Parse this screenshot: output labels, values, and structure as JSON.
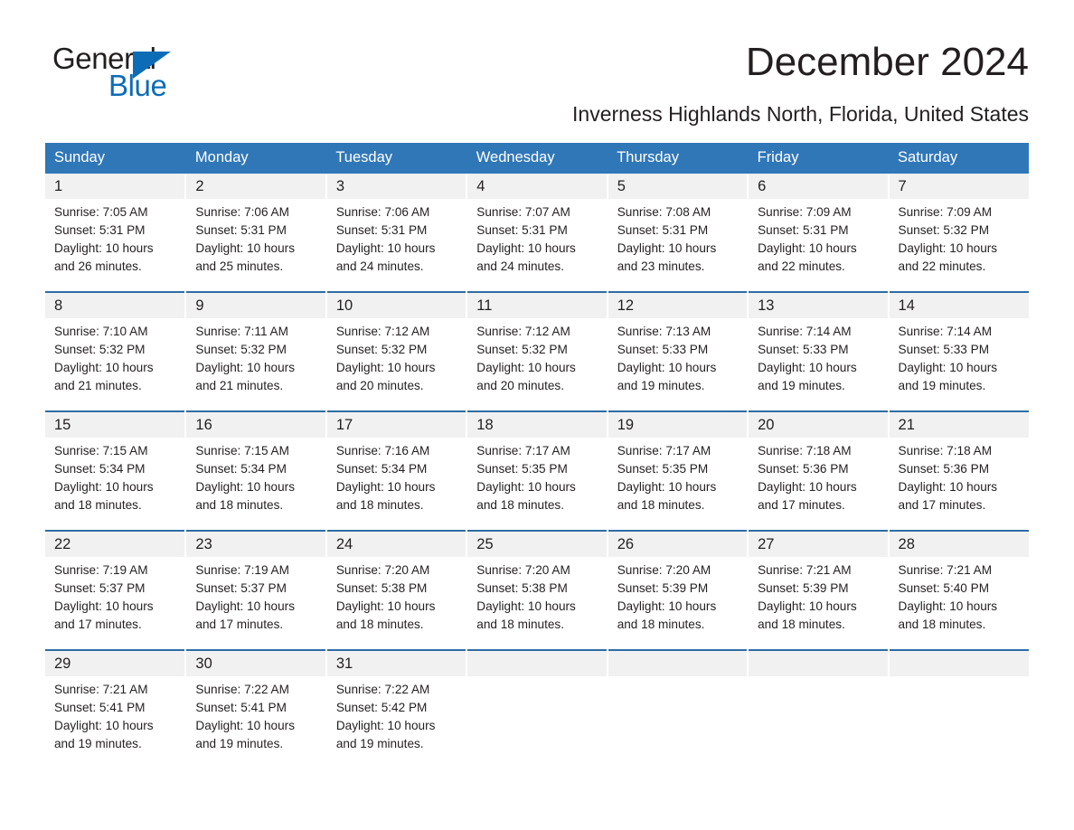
{
  "brand": {
    "name_part1": "General",
    "name_part2": "Blue",
    "logo_icon": "triangle-icon"
  },
  "header": {
    "title": "December 2024",
    "subtitle": "Inverness Highlands North, Florida, United States"
  },
  "colors": {
    "header_blue": "#3077b8",
    "rule_blue": "#2e6da4",
    "brand_blue": "#0d6cb6",
    "date_band_gray": "#f1f1f1",
    "text": "#231f20"
  },
  "weekdays": [
    "Sunday",
    "Monday",
    "Tuesday",
    "Wednesday",
    "Thursday",
    "Friday",
    "Saturday"
  ],
  "weeks": [
    {
      "dates": [
        "1",
        "2",
        "3",
        "4",
        "5",
        "6",
        "7"
      ],
      "cells": [
        {
          "sunrise": "Sunrise: 7:05 AM",
          "sunset": "Sunset: 5:31 PM",
          "daylight1": "Daylight: 10 hours",
          "daylight2": "and 26 minutes."
        },
        {
          "sunrise": "Sunrise: 7:06 AM",
          "sunset": "Sunset: 5:31 PM",
          "daylight1": "Daylight: 10 hours",
          "daylight2": "and 25 minutes."
        },
        {
          "sunrise": "Sunrise: 7:06 AM",
          "sunset": "Sunset: 5:31 PM",
          "daylight1": "Daylight: 10 hours",
          "daylight2": "and 24 minutes."
        },
        {
          "sunrise": "Sunrise: 7:07 AM",
          "sunset": "Sunset: 5:31 PM",
          "daylight1": "Daylight: 10 hours",
          "daylight2": "and 24 minutes."
        },
        {
          "sunrise": "Sunrise: 7:08 AM",
          "sunset": "Sunset: 5:31 PM",
          "daylight1": "Daylight: 10 hours",
          "daylight2": "and 23 minutes."
        },
        {
          "sunrise": "Sunrise: 7:09 AM",
          "sunset": "Sunset: 5:31 PM",
          "daylight1": "Daylight: 10 hours",
          "daylight2": "and 22 minutes."
        },
        {
          "sunrise": "Sunrise: 7:09 AM",
          "sunset": "Sunset: 5:32 PM",
          "daylight1": "Daylight: 10 hours",
          "daylight2": "and 22 minutes."
        }
      ]
    },
    {
      "dates": [
        "8",
        "9",
        "10",
        "11",
        "12",
        "13",
        "14"
      ],
      "cells": [
        {
          "sunrise": "Sunrise: 7:10 AM",
          "sunset": "Sunset: 5:32 PM",
          "daylight1": "Daylight: 10 hours",
          "daylight2": "and 21 minutes."
        },
        {
          "sunrise": "Sunrise: 7:11 AM",
          "sunset": "Sunset: 5:32 PM",
          "daylight1": "Daylight: 10 hours",
          "daylight2": "and 21 minutes."
        },
        {
          "sunrise": "Sunrise: 7:12 AM",
          "sunset": "Sunset: 5:32 PM",
          "daylight1": "Daylight: 10 hours",
          "daylight2": "and 20 minutes."
        },
        {
          "sunrise": "Sunrise: 7:12 AM",
          "sunset": "Sunset: 5:32 PM",
          "daylight1": "Daylight: 10 hours",
          "daylight2": "and 20 minutes."
        },
        {
          "sunrise": "Sunrise: 7:13 AM",
          "sunset": "Sunset: 5:33 PM",
          "daylight1": "Daylight: 10 hours",
          "daylight2": "and 19 minutes."
        },
        {
          "sunrise": "Sunrise: 7:14 AM",
          "sunset": "Sunset: 5:33 PM",
          "daylight1": "Daylight: 10 hours",
          "daylight2": "and 19 minutes."
        },
        {
          "sunrise": "Sunrise: 7:14 AM",
          "sunset": "Sunset: 5:33 PM",
          "daylight1": "Daylight: 10 hours",
          "daylight2": "and 19 minutes."
        }
      ]
    },
    {
      "dates": [
        "15",
        "16",
        "17",
        "18",
        "19",
        "20",
        "21"
      ],
      "cells": [
        {
          "sunrise": "Sunrise: 7:15 AM",
          "sunset": "Sunset: 5:34 PM",
          "daylight1": "Daylight: 10 hours",
          "daylight2": "and 18 minutes."
        },
        {
          "sunrise": "Sunrise: 7:15 AM",
          "sunset": "Sunset: 5:34 PM",
          "daylight1": "Daylight: 10 hours",
          "daylight2": "and 18 minutes."
        },
        {
          "sunrise": "Sunrise: 7:16 AM",
          "sunset": "Sunset: 5:34 PM",
          "daylight1": "Daylight: 10 hours",
          "daylight2": "and 18 minutes."
        },
        {
          "sunrise": "Sunrise: 7:17 AM",
          "sunset": "Sunset: 5:35 PM",
          "daylight1": "Daylight: 10 hours",
          "daylight2": "and 18 minutes."
        },
        {
          "sunrise": "Sunrise: 7:17 AM",
          "sunset": "Sunset: 5:35 PM",
          "daylight1": "Daylight: 10 hours",
          "daylight2": "and 18 minutes."
        },
        {
          "sunrise": "Sunrise: 7:18 AM",
          "sunset": "Sunset: 5:36 PM",
          "daylight1": "Daylight: 10 hours",
          "daylight2": "and 17 minutes."
        },
        {
          "sunrise": "Sunrise: 7:18 AM",
          "sunset": "Sunset: 5:36 PM",
          "daylight1": "Daylight: 10 hours",
          "daylight2": "and 17 minutes."
        }
      ]
    },
    {
      "dates": [
        "22",
        "23",
        "24",
        "25",
        "26",
        "27",
        "28"
      ],
      "cells": [
        {
          "sunrise": "Sunrise: 7:19 AM",
          "sunset": "Sunset: 5:37 PM",
          "daylight1": "Daylight: 10 hours",
          "daylight2": "and 17 minutes."
        },
        {
          "sunrise": "Sunrise: 7:19 AM",
          "sunset": "Sunset: 5:37 PM",
          "daylight1": "Daylight: 10 hours",
          "daylight2": "and 17 minutes."
        },
        {
          "sunrise": "Sunrise: 7:20 AM",
          "sunset": "Sunset: 5:38 PM",
          "daylight1": "Daylight: 10 hours",
          "daylight2": "and 18 minutes."
        },
        {
          "sunrise": "Sunrise: 7:20 AM",
          "sunset": "Sunset: 5:38 PM",
          "daylight1": "Daylight: 10 hours",
          "daylight2": "and 18 minutes."
        },
        {
          "sunrise": "Sunrise: 7:20 AM",
          "sunset": "Sunset: 5:39 PM",
          "daylight1": "Daylight: 10 hours",
          "daylight2": "and 18 minutes."
        },
        {
          "sunrise": "Sunrise: 7:21 AM",
          "sunset": "Sunset: 5:39 PM",
          "daylight1": "Daylight: 10 hours",
          "daylight2": "and 18 minutes."
        },
        {
          "sunrise": "Sunrise: 7:21 AM",
          "sunset": "Sunset: 5:40 PM",
          "daylight1": "Daylight: 10 hours",
          "daylight2": "and 18 minutes."
        }
      ]
    },
    {
      "dates": [
        "29",
        "30",
        "31",
        "",
        "",
        "",
        ""
      ],
      "cells": [
        {
          "sunrise": "Sunrise: 7:21 AM",
          "sunset": "Sunset: 5:41 PM",
          "daylight1": "Daylight: 10 hours",
          "daylight2": "and 19 minutes."
        },
        {
          "sunrise": "Sunrise: 7:22 AM",
          "sunset": "Sunset: 5:41 PM",
          "daylight1": "Daylight: 10 hours",
          "daylight2": "and 19 minutes."
        },
        {
          "sunrise": "Sunrise: 7:22 AM",
          "sunset": "Sunset: 5:42 PM",
          "daylight1": "Daylight: 10 hours",
          "daylight2": "and 19 minutes."
        },
        {
          "sunrise": "",
          "sunset": "",
          "daylight1": "",
          "daylight2": ""
        },
        {
          "sunrise": "",
          "sunset": "",
          "daylight1": "",
          "daylight2": ""
        },
        {
          "sunrise": "",
          "sunset": "",
          "daylight1": "",
          "daylight2": ""
        },
        {
          "sunrise": "",
          "sunset": "",
          "daylight1": "",
          "daylight2": ""
        }
      ]
    }
  ]
}
